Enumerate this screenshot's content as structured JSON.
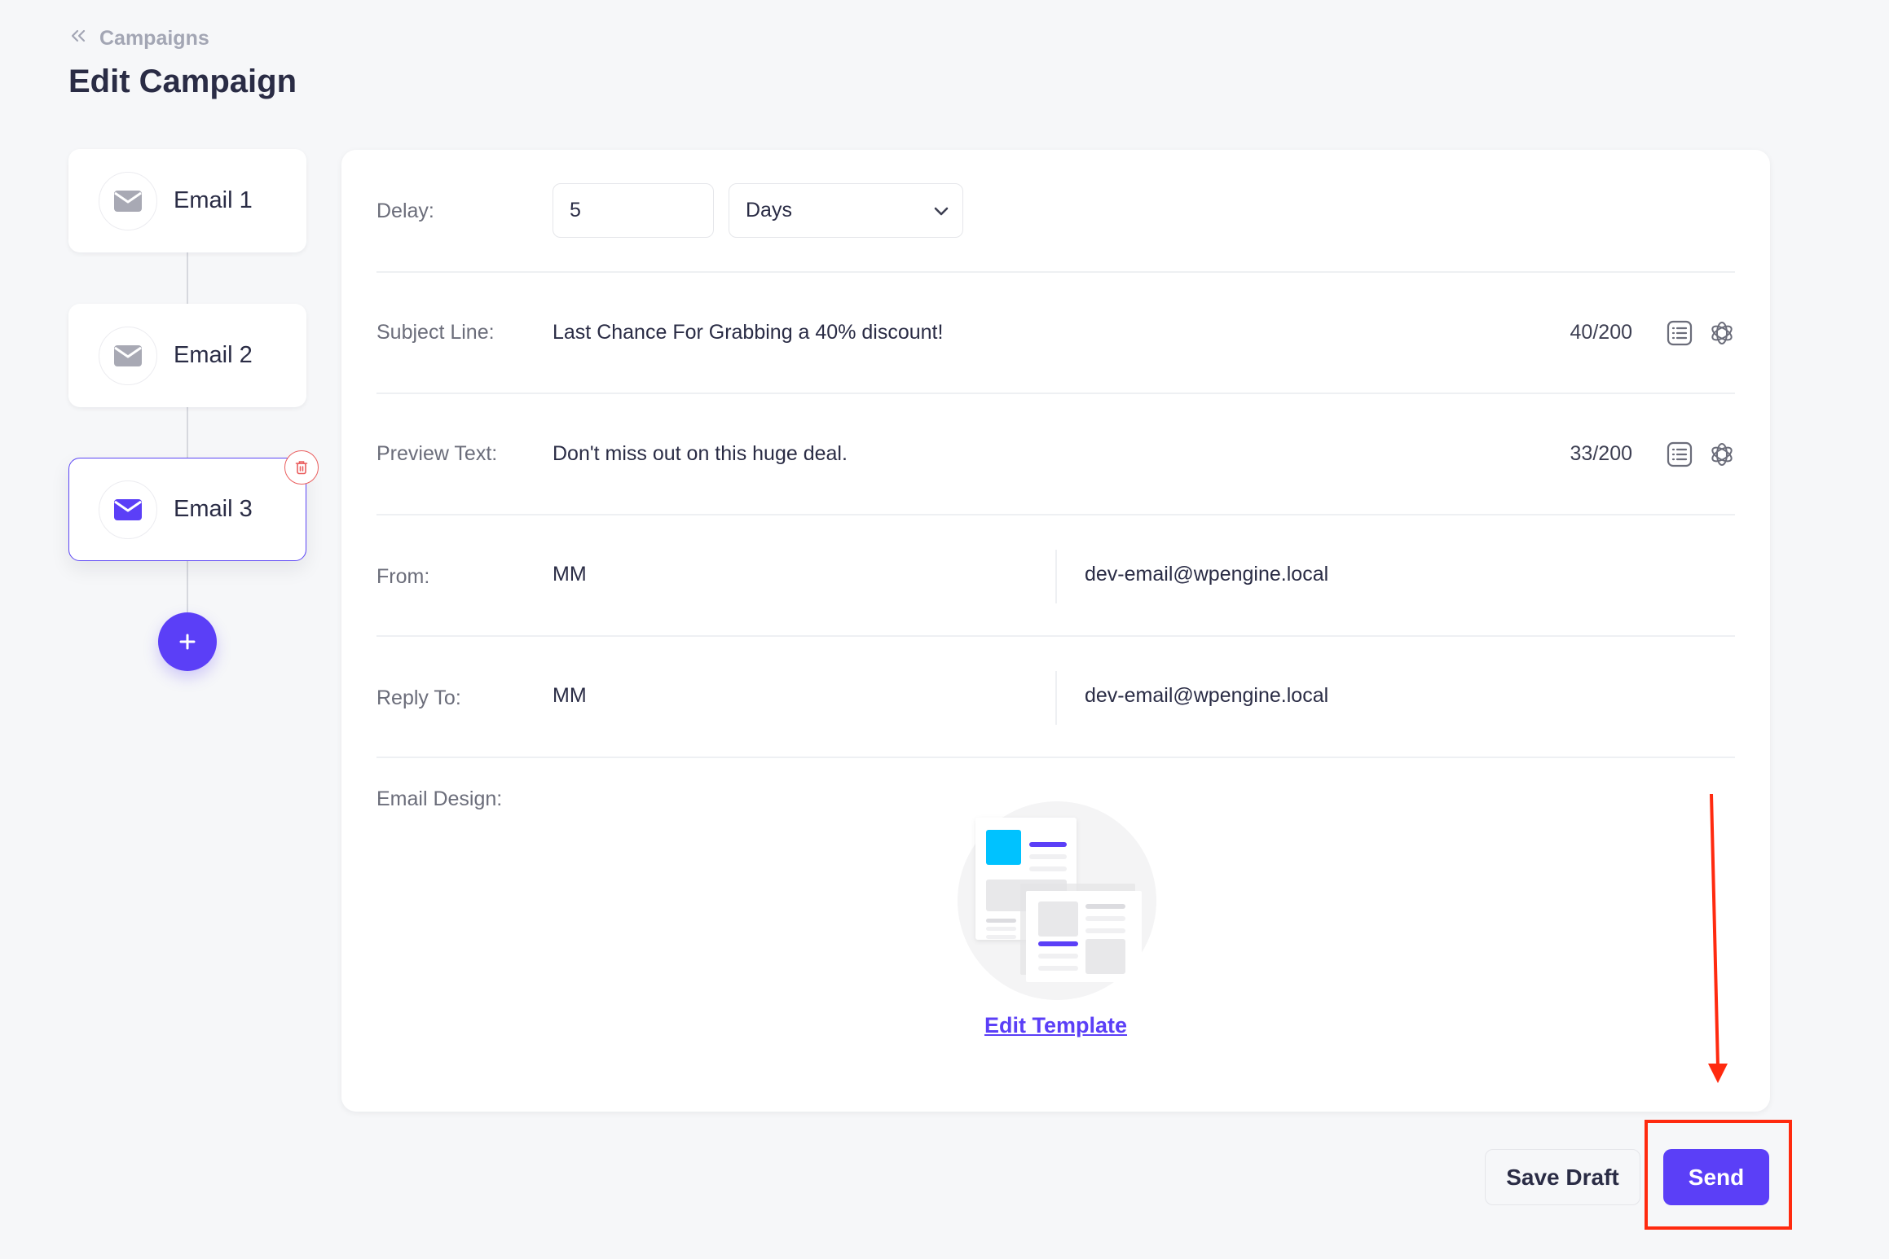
{
  "breadcrumb": {
    "label": "Campaigns",
    "icon": "double-chevron-left-icon"
  },
  "page_title": "Edit Campaign",
  "sequence": {
    "emails": [
      {
        "label": "Email 1",
        "active": false
      },
      {
        "label": "Email 2",
        "active": false
      },
      {
        "label": "Email 3",
        "active": true
      }
    ],
    "add_button_label": "+"
  },
  "form": {
    "delay": {
      "label": "Delay:",
      "value": "5",
      "unit": "Days"
    },
    "subject": {
      "label": "Subject Line:",
      "value": "Last Chance For Grabbing a 40% discount!",
      "counter": "40/200"
    },
    "preview": {
      "label": "Preview Text:",
      "value": "Don't miss out on this huge deal.",
      "counter": "33/200"
    },
    "from": {
      "label": "From:",
      "name": "MM",
      "email": "dev-email@wpengine.local"
    },
    "reply_to": {
      "label": "Reply To:",
      "name": "MM",
      "email": "dev-email@wpengine.local"
    },
    "design": {
      "label": "Email Design:",
      "edit_link": "Edit Template"
    }
  },
  "actions": {
    "save_draft": "Save Draft",
    "send": "Send"
  },
  "colors": {
    "accent": "#5b3ff7",
    "danger": "#ea5e5e",
    "annotation": "#ff2a0f"
  }
}
